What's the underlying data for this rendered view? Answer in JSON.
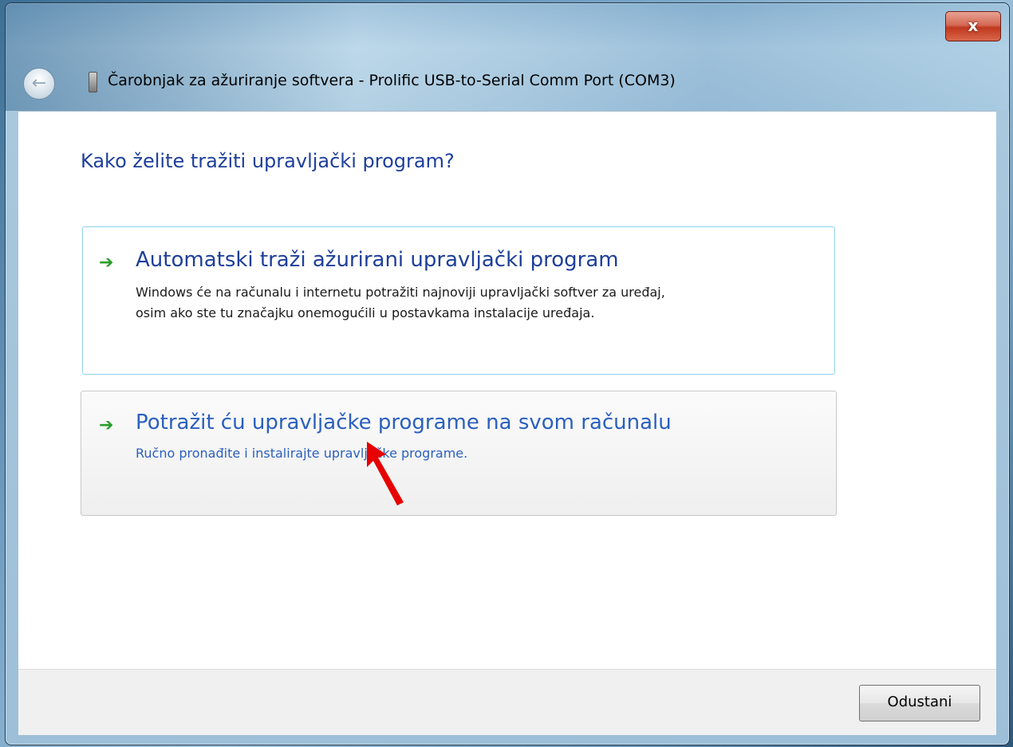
{
  "window": {
    "title": "Čarobnjak za ažuriranje softvera - Prolific USB-to-Serial Comm Port (COM3)",
    "close_label": "x"
  },
  "main": {
    "heading": "Kako želite tražiti upravljački program?",
    "options": [
      {
        "title": "Automatski traži ažurirani upravljački program",
        "description_line1": "Windows će na računalu i internetu potražiti najnoviji upravljački softver za uređaj,",
        "description_line2": "osim ako ste tu značajku onemogućili u postavkama instalacije uređaja."
      },
      {
        "title": "Potražit ću upravljačke programe na svom računalu",
        "description_line1": "Ručno pronađite i instalirajte upravljačke programe."
      }
    ]
  },
  "footer": {
    "cancel_label": "Odustani"
  },
  "colors": {
    "heading": "#1e3f9b",
    "link": "#2b5fbe",
    "arrow": "#2a9d2a",
    "annotation": "#e60000"
  },
  "icons": {
    "option_arrow": "green-arrow-icon",
    "back": "back-arrow-icon",
    "device": "usb-device-icon",
    "annotation": "red-pointer-arrow"
  }
}
